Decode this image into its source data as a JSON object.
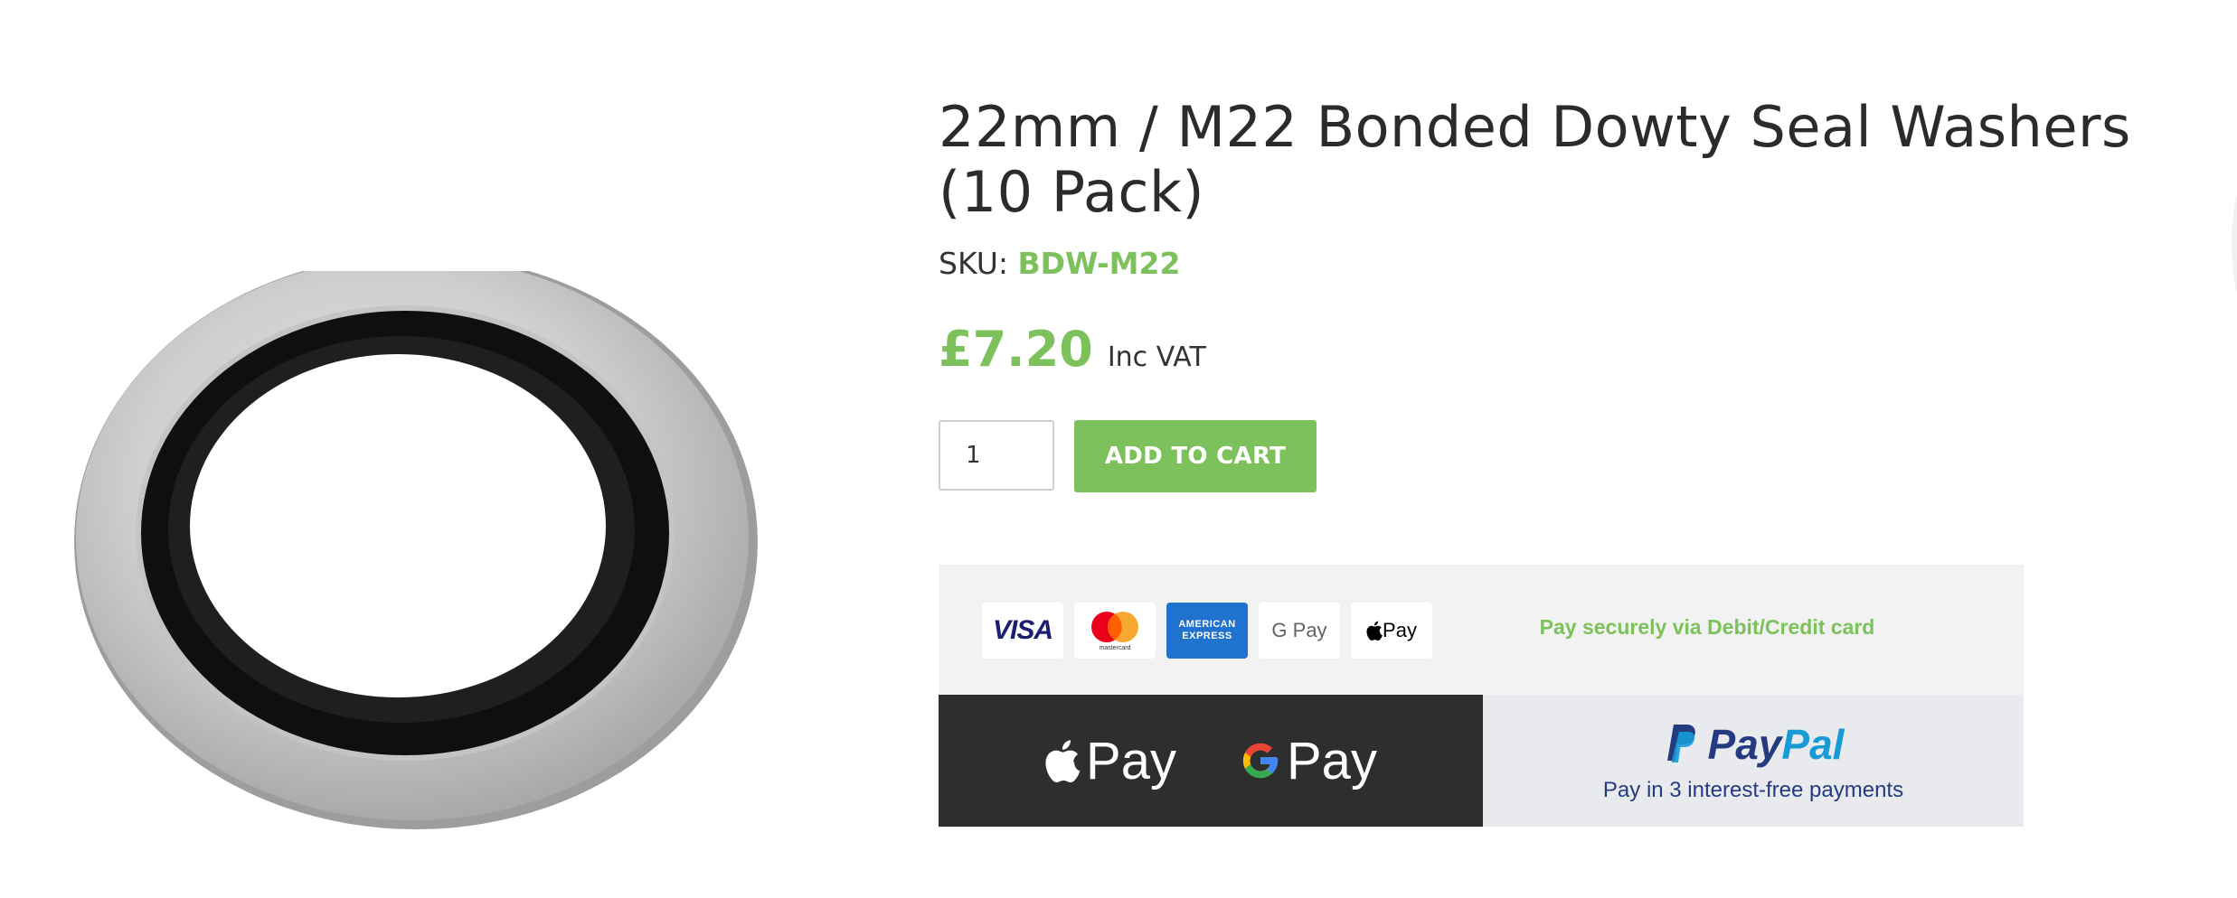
{
  "product": {
    "title": "22mm / M22 Bonded Dowty Seal Washers (10 Pack)",
    "sku_label": "SKU:",
    "sku_value": "BDW-M22",
    "price": "£7.20",
    "price_suffix": "Inc VAT",
    "image_icon": "bonded-seal-washer-photo"
  },
  "cart": {
    "quantity": "1",
    "add_to_cart_label": "ADD TO CART"
  },
  "payments": {
    "cards": {
      "visa": "VISA",
      "mastercard": "mastercard",
      "amex_line1": "AMERICAN",
      "amex_line2": "EXPRESS",
      "gpay": "G Pay",
      "applepay": "Pay"
    },
    "secure_text": "Pay securely via Debit/Credit card",
    "apple_pay": "Pay",
    "google_pay": "Pay",
    "paypal_part1": "Pay",
    "paypal_part2": "Pal",
    "paypal_sub": "Pay in 3 interest-free payments"
  },
  "colors": {
    "accent_green": "#7cc15c",
    "dark_panel": "#2e2e2e",
    "paypal_navy": "#253b80",
    "paypal_blue": "#179bd7"
  }
}
